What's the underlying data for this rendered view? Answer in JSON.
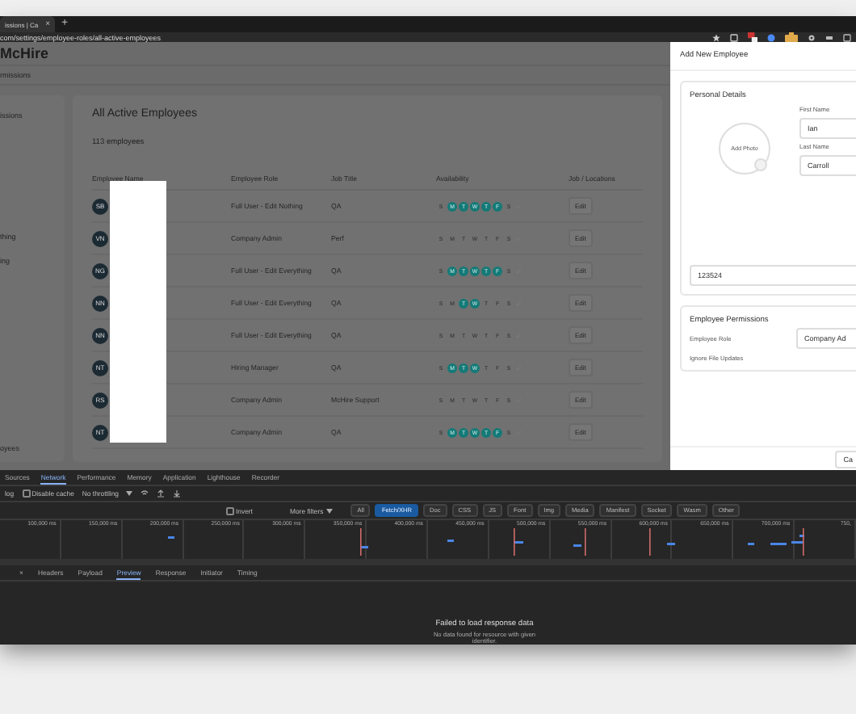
{
  "browser": {
    "tab_title": "issions | Ca",
    "new_tab": "+",
    "tab_close": "×",
    "url": "com/settings/employee-roles/all-active-employees"
  },
  "app": {
    "brand": "McHire",
    "breadcrumb": "rmissions",
    "sidebar": [
      "issions",
      "thing",
      "ing",
      "oyees"
    ]
  },
  "employees": {
    "title": "All Active Employees",
    "count": "113 employees",
    "columns": [
      "Employee Name",
      "Employee Role",
      "Job Title",
      "Availability",
      "Job / Locations"
    ],
    "rows": [
      {
        "initials": "SB",
        "role": "Full User - Edit Nothing",
        "job_title": "QA",
        "days": [
          {
            "d": "S",
            "on": false
          },
          {
            "d": "M",
            "on": true
          },
          {
            "d": "T",
            "on": true
          },
          {
            "d": "W",
            "on": true
          },
          {
            "d": "T",
            "on": true
          },
          {
            "d": "F",
            "on": true
          },
          {
            "d": "S",
            "on": false
          }
        ],
        "action": "Edit"
      },
      {
        "initials": "VN",
        "role": "Company Admin",
        "job_title": "Perf",
        "days": [
          {
            "d": "S",
            "on": false
          },
          {
            "d": "M",
            "on": false
          },
          {
            "d": "T",
            "on": false
          },
          {
            "d": "W",
            "on": false
          },
          {
            "d": "T",
            "on": false
          },
          {
            "d": "F",
            "on": false
          },
          {
            "d": "S",
            "on": false
          }
        ],
        "action": "Edit"
      },
      {
        "initials": "NG",
        "role": "Full User - Edit Everything",
        "job_title": "QA",
        "days": [
          {
            "d": "S",
            "on": false
          },
          {
            "d": "M",
            "on": true
          },
          {
            "d": "T",
            "on": true
          },
          {
            "d": "W",
            "on": true
          },
          {
            "d": "T",
            "on": true
          },
          {
            "d": "F",
            "on": true
          },
          {
            "d": "S",
            "on": false
          }
        ],
        "action": "Edit"
      },
      {
        "initials": "NN",
        "role": "Full User - Edit Everything",
        "job_title": "QA",
        "days": [
          {
            "d": "S",
            "on": false
          },
          {
            "d": "M",
            "on": false
          },
          {
            "d": "T",
            "on": true
          },
          {
            "d": "W",
            "on": true
          },
          {
            "d": "T",
            "on": false
          },
          {
            "d": "F",
            "on": false
          },
          {
            "d": "S",
            "on": false
          }
        ],
        "action": "Edit"
      },
      {
        "initials": "NN",
        "role": "Full User - Edit Everything",
        "job_title": "QA",
        "days": [
          {
            "d": "S",
            "on": false
          },
          {
            "d": "M",
            "on": false
          },
          {
            "d": "T",
            "on": false
          },
          {
            "d": "W",
            "on": false
          },
          {
            "d": "T",
            "on": false
          },
          {
            "d": "F",
            "on": false
          },
          {
            "d": "S",
            "on": false
          }
        ],
        "action": "Edit"
      },
      {
        "initials": "NT",
        "role": "Hiring Manager",
        "job_title": "QA",
        "days": [
          {
            "d": "S",
            "on": false
          },
          {
            "d": "M",
            "on": true
          },
          {
            "d": "T",
            "on": true
          },
          {
            "d": "W",
            "on": true
          },
          {
            "d": "T",
            "on": false
          },
          {
            "d": "F",
            "on": false
          },
          {
            "d": "S",
            "on": false
          }
        ],
        "action": "Edit"
      },
      {
        "initials": "RS",
        "role": "Company Admin",
        "job_title": "McHire Support",
        "days": [
          {
            "d": "S",
            "on": false
          },
          {
            "d": "M",
            "on": false
          },
          {
            "d": "T",
            "on": false
          },
          {
            "d": "W",
            "on": false
          },
          {
            "d": "T",
            "on": false
          },
          {
            "d": "F",
            "on": false
          },
          {
            "d": "S",
            "on": false
          }
        ],
        "action": "Edit"
      },
      {
        "initials": "NT",
        "role": "Company Admin",
        "job_title": "QA",
        "days": [
          {
            "d": "S",
            "on": false
          },
          {
            "d": "M",
            "on": true
          },
          {
            "d": "T",
            "on": true
          },
          {
            "d": "W",
            "on": true
          },
          {
            "d": "T",
            "on": true
          },
          {
            "d": "F",
            "on": true
          },
          {
            "d": "S",
            "on": false
          }
        ],
        "action": "Edit"
      }
    ]
  },
  "drawer": {
    "title": "Add New Employee",
    "personal_heading": "Personal Details",
    "add_photo": "Add Photo",
    "first_name_label": "First Name",
    "first_name": "Ian",
    "last_name_label": "Last Name",
    "last_name": "Carroll",
    "id_value": "123524",
    "permissions_heading": "Employee Permissions",
    "role_label": "Employee Role",
    "role_value": "Company Ad",
    "ignore_label": "Ignore File Updates",
    "footer_button": "Ca"
  },
  "devtools": {
    "tabs": [
      {
        "label": "Sources",
        "selected": false
      },
      {
        "label": "Network",
        "selected": true
      },
      {
        "label": "Performance",
        "selected": false
      },
      {
        "label": "Memory",
        "selected": false
      },
      {
        "label": "Application",
        "selected": false
      },
      {
        "label": "Lighthouse",
        "selected": false
      },
      {
        "label": "Recorder",
        "selected": false
      }
    ],
    "preserve_log": "log",
    "disable_cache": {
      "label": "Disable cache",
      "checked": false
    },
    "throttling": "No throttling",
    "invert": {
      "label": "Invert",
      "checked": false
    },
    "more_filters": "More filters",
    "filters": [
      {
        "label": "All",
        "selected": false
      },
      {
        "label": "Fetch/XHR",
        "selected": true
      },
      {
        "label": "Doc",
        "selected": false
      },
      {
        "label": "CSS",
        "selected": false
      },
      {
        "label": "JS",
        "selected": false
      },
      {
        "label": "Font",
        "selected": false
      },
      {
        "label": "Img",
        "selected": false
      },
      {
        "label": "Media",
        "selected": false
      },
      {
        "label": "Manifest",
        "selected": false
      },
      {
        "label": "Socket",
        "selected": false
      },
      {
        "label": "Wasm",
        "selected": false
      },
      {
        "label": "Other",
        "selected": false
      }
    ],
    "timeline_ticks": [
      "100,000 ms",
      "150,000 ms",
      "200,000 ms",
      "250,000 ms",
      "300,000 ms",
      "350,000 ms",
      "400,000 ms",
      "450,000 ms",
      "500,000 ms",
      "550,000 ms",
      "600,000 ms",
      "650,000 ms",
      "700,000 ms",
      "750,"
    ],
    "detail_close": "×",
    "detail_tabs": [
      {
        "label": "Headers",
        "selected": false
      },
      {
        "label": "Payload",
        "selected": false
      },
      {
        "label": "Preview",
        "selected": true
      },
      {
        "label": "Response",
        "selected": false
      },
      {
        "label": "Initiator",
        "selected": false
      },
      {
        "label": "Timing",
        "selected": false
      }
    ],
    "message": "Failed to load response data",
    "message_detail": "No data found for resource with given identifier."
  }
}
